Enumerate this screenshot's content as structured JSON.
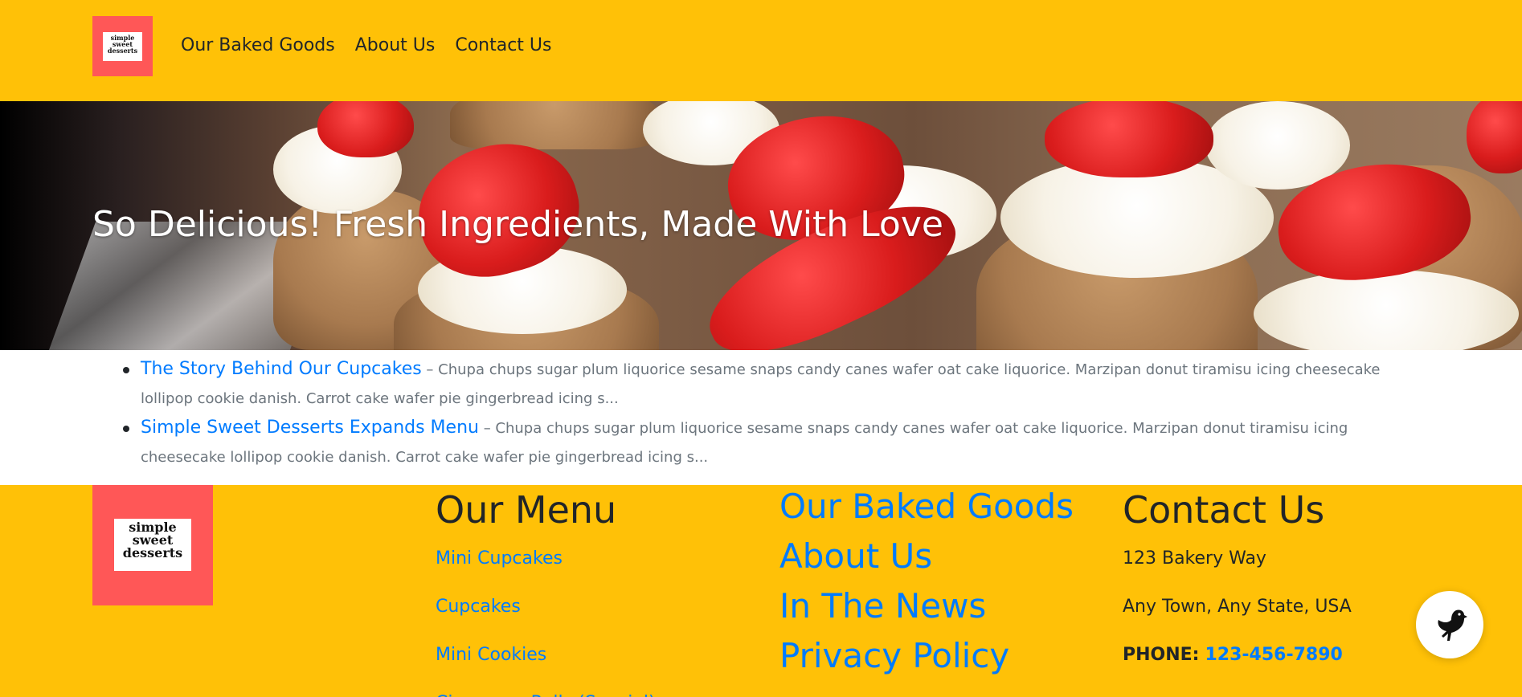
{
  "header": {
    "logo_text": "simple sweet desserts",
    "nav": [
      "Our Baked Goods",
      "About Us",
      "Contact Us"
    ]
  },
  "hero": {
    "title": "So Delicious! Fresh Ingredients, Made With Love"
  },
  "posts": [
    {
      "title": "The Story Behind Our Cupcakes",
      "excerpt": " – Chupa chups sugar plum liquorice sesame snaps candy canes wafer oat cake liquorice. Marzipan donut tiramisu icing cheesecake lollipop cookie danish. Carrot cake wafer pie gingerbread icing s..."
    },
    {
      "title": "Simple Sweet Desserts Expands Menu",
      "excerpt": " – Chupa chups sugar plum liquorice sesame snaps candy canes wafer oat cake liquorice. Marzipan donut tiramisu icing cheesecake lollipop cookie danish. Carrot cake wafer pie gingerbread icing s..."
    }
  ],
  "footer": {
    "logo_text": "simple sweet desserts",
    "menu": {
      "heading": "Our Menu",
      "items": [
        "Mini Cupcakes",
        "Cupcakes",
        "Mini Cookies",
        "Cinnamon Rolls (Special)"
      ]
    },
    "links": [
      "Our Baked Goods",
      "About Us",
      "In The News",
      "Privacy Policy"
    ],
    "contact": {
      "heading": "Contact Us",
      "address1": "123 Bakery Way",
      "address2": "Any Town, Any State, USA",
      "phone_label": "PHONE:",
      "phone": "123-456-7890"
    }
  },
  "widget": {
    "icon": "bird-icon"
  },
  "colors": {
    "header_bg": "#ffc107",
    "logo_bg": "#ff5757",
    "link": "#007bff"
  }
}
